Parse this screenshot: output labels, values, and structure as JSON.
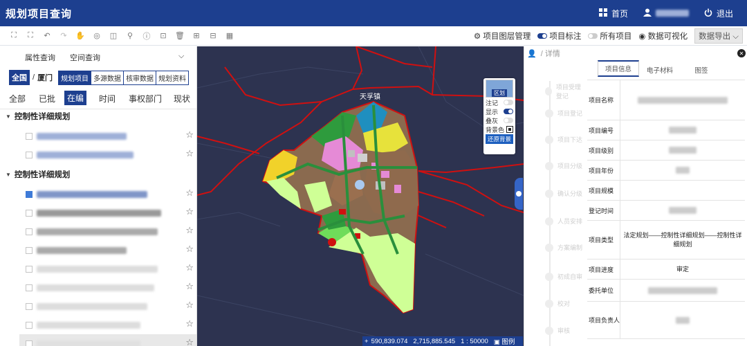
{
  "header": {
    "title": "规划项目查询",
    "home_label": "首页",
    "logout_label": "退出"
  },
  "toolbar": {
    "layer_mgmt": "项目图层管理",
    "project_label": "项目标注",
    "all_projects": "所有项目",
    "data_visual": "数据可视化",
    "export": "数据导出"
  },
  "left": {
    "tabs": [
      "属性查询",
      "空间查询"
    ],
    "region_all": "全国",
    "region_sep": "/",
    "region_city": "厦门",
    "segments": [
      "规划项目",
      "多源数据",
      "核审数据",
      "规划资料"
    ],
    "status_filters": [
      "全部",
      "已批",
      "在编",
      "时间",
      "事权部门",
      "现状"
    ],
    "group1": "控制性详细规划",
    "group2": "控制性详细规划"
  },
  "map": {
    "place_label": "天孚镇",
    "legend_title": "区划",
    "legend_rows": [
      "注记",
      "显示",
      "叠灰",
      "背景色"
    ],
    "restore_btn": "还原背景",
    "coord_x": "590,839.074",
    "coord_y": "2,715,885.545",
    "scale": "1 : 50000",
    "legend_btn": "图例"
  },
  "right": {
    "breadcrumb": "/ 详情",
    "tabs": [
      "项目信息",
      "电子材料",
      "图签"
    ],
    "timeline": [
      "项目受理登记",
      "项目登记",
      "项目下达",
      "项目分级",
      "确认分级",
      "人员安排",
      "方案编制",
      "初成自审",
      "校对",
      "审核"
    ],
    "fields": [
      {
        "label": "项目名称",
        "value": ""
      },
      {
        "label": "项目编号",
        "value": ""
      },
      {
        "label": "项目级别",
        "value": ""
      },
      {
        "label": "项目年份",
        "value": ""
      },
      {
        "label": "项目规模",
        "value": ""
      },
      {
        "label": "登记时间",
        "value": ""
      },
      {
        "label": "项目类型",
        "value": "法定规划——控制性详细规划——控制性详细规划"
      },
      {
        "label": "项目进度",
        "value": "审定"
      },
      {
        "label": "委托单位",
        "value": ""
      },
      {
        "label": "项目负责人",
        "value": ""
      }
    ]
  },
  "colors": {
    "brand": "#1d3f8f",
    "boundary": "#d01010",
    "map_bg": "#2d3350"
  }
}
